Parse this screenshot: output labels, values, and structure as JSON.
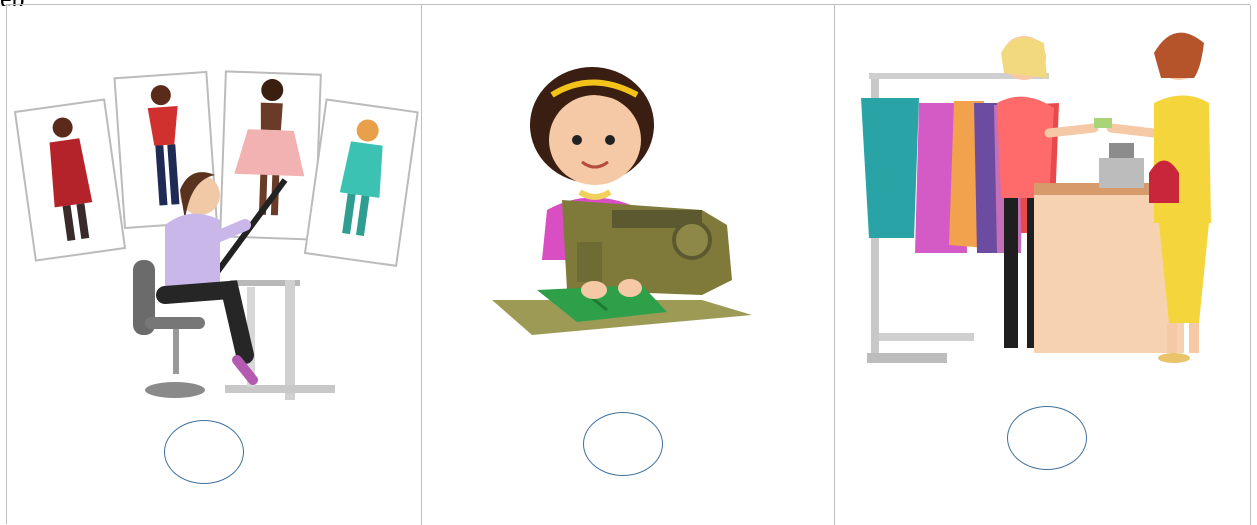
{
  "document": {
    "top_text_fragment": "ep",
    "cells": [
      {
        "illustration_icon": "fashion-designer-sketching-illustration",
        "answer_mark": ""
      },
      {
        "illustration_icon": "seamstress-sewing-machine-illustration",
        "answer_mark": ""
      },
      {
        "illustration_icon": "clothing-shop-sales-assistant-illustration",
        "answer_mark": ""
      }
    ]
  },
  "colors": {
    "border": "#bfbfbf",
    "circle_stroke": "#41719c"
  }
}
